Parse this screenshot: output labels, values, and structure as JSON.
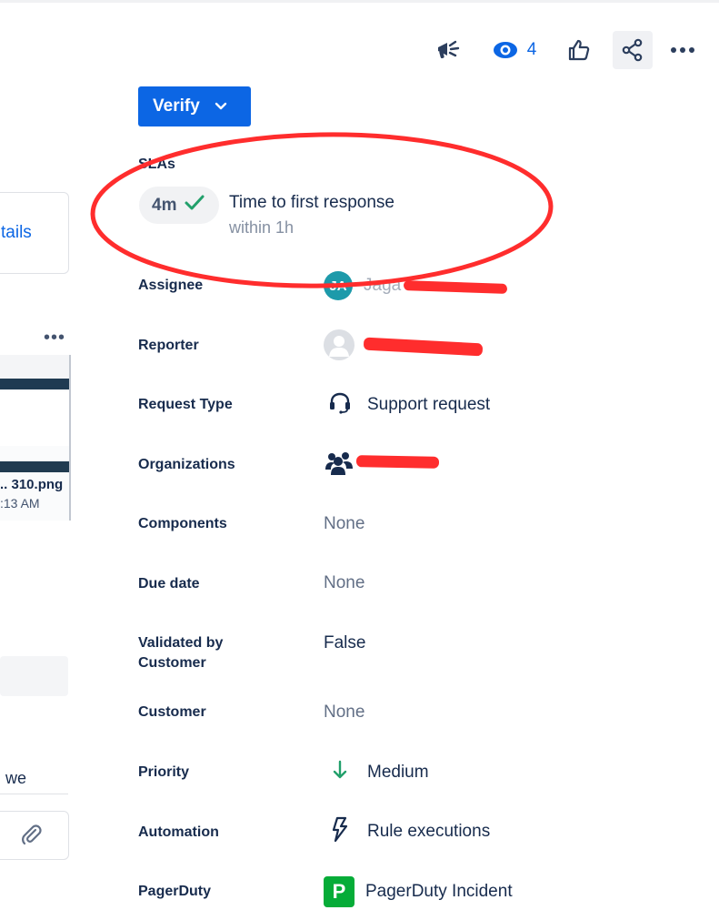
{
  "toolbar": {
    "watchers_count": "4"
  },
  "left": {
    "card_link": "tails",
    "attachment_name": ".. 310.png",
    "attachment_time": ":13 AM",
    "comment_fragment": "we"
  },
  "actions": {
    "verify_label": "Verify"
  },
  "sla": {
    "heading": "SLAs",
    "elapsed": "4m",
    "title": "Time to first response",
    "target": "within 1h"
  },
  "fields": {
    "assignee": {
      "label": "Assignee",
      "initials": "JA",
      "value": "Jaga"
    },
    "reporter": {
      "label": "Reporter"
    },
    "request_type": {
      "label": "Request Type",
      "value": "Support request"
    },
    "organizations": {
      "label": "Organizations"
    },
    "components": {
      "label": "Components",
      "value": "None"
    },
    "due_date": {
      "label": "Due date",
      "value": "None"
    },
    "validated": {
      "label": "Validated by Customer",
      "value": "False"
    },
    "customer": {
      "label": "Customer",
      "value": "None"
    },
    "priority": {
      "label": "Priority",
      "value": "Medium"
    },
    "automation": {
      "label": "Automation",
      "value": "Rule executions"
    },
    "pagerduty": {
      "label": "PagerDuty",
      "logo_letter": "P",
      "value": "PagerDuty Incident"
    }
  },
  "colors": {
    "brand_blue": "#0c66e4",
    "annotation_red": "#ff2d2d",
    "sla_check": "#22a06b",
    "priority_green": "#22a06b",
    "pagerduty_green": "#06ac38"
  }
}
